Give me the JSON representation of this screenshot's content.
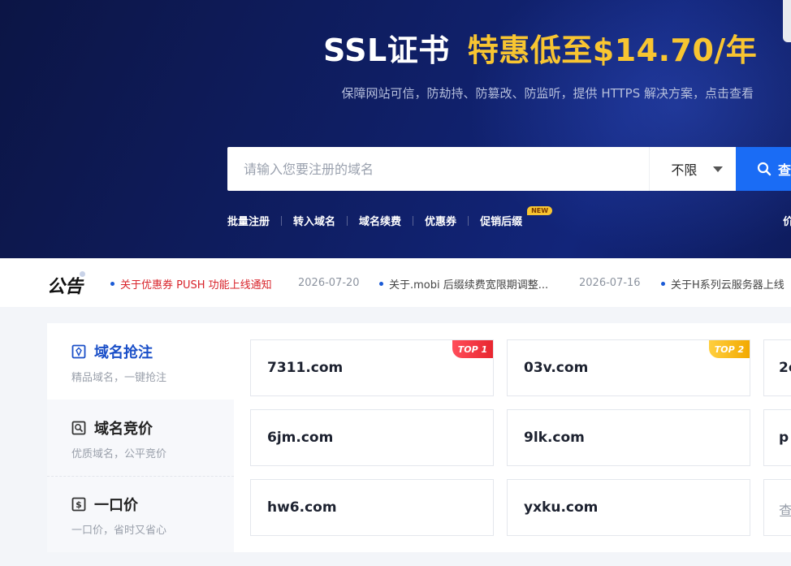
{
  "hero": {
    "headline_white": "SSL证书",
    "headline_gold": "特惠低至$14.70/年",
    "subline": "保障网站可信，防劫持、防篡改、防监听，提供 HTTPS 解决方案，点击查看"
  },
  "search": {
    "placeholder": "请输入您要注册的域名",
    "filter_value": "不限",
    "button_label": "查"
  },
  "quicklinks": {
    "items": [
      "批量注册",
      "转入域名",
      "域名续费",
      "优惠券",
      "促销后缀"
    ],
    "new_badge": "NEW",
    "right_partial": "价"
  },
  "notice": {
    "title": "公告",
    "items": [
      {
        "text": "关于优惠券 PUSH 功能上线通知",
        "date": "2026-07-20"
      },
      {
        "text": "关于.mobi 后缀续费宽限期调整...",
        "date": "2026-07-16"
      },
      {
        "text": "关于H系列云服务器上线"
      }
    ]
  },
  "sidebar": {
    "items": [
      {
        "title": "域名抢注",
        "subtitle": "精品域名，一键抢注"
      },
      {
        "title": "域名竞价",
        "subtitle": "优质域名，公平竞价"
      },
      {
        "title": "一口价",
        "subtitle": "一口价，省时又省心"
      }
    ]
  },
  "domains": {
    "rows": [
      [
        "7311.com",
        "03v.com",
        "2c"
      ],
      [
        "6jm.com",
        "9lk.com",
        "p"
      ],
      [
        "hw6.com",
        "yxku.com",
        "查"
      ]
    ],
    "rank1": "TOP 1",
    "rank2": "TOP 2"
  },
  "colors": {
    "hero_bg": "#0f1e63",
    "gold": "#f8c531",
    "accent_blue": "#1a6cf5",
    "notice_red": "#d8232a"
  }
}
